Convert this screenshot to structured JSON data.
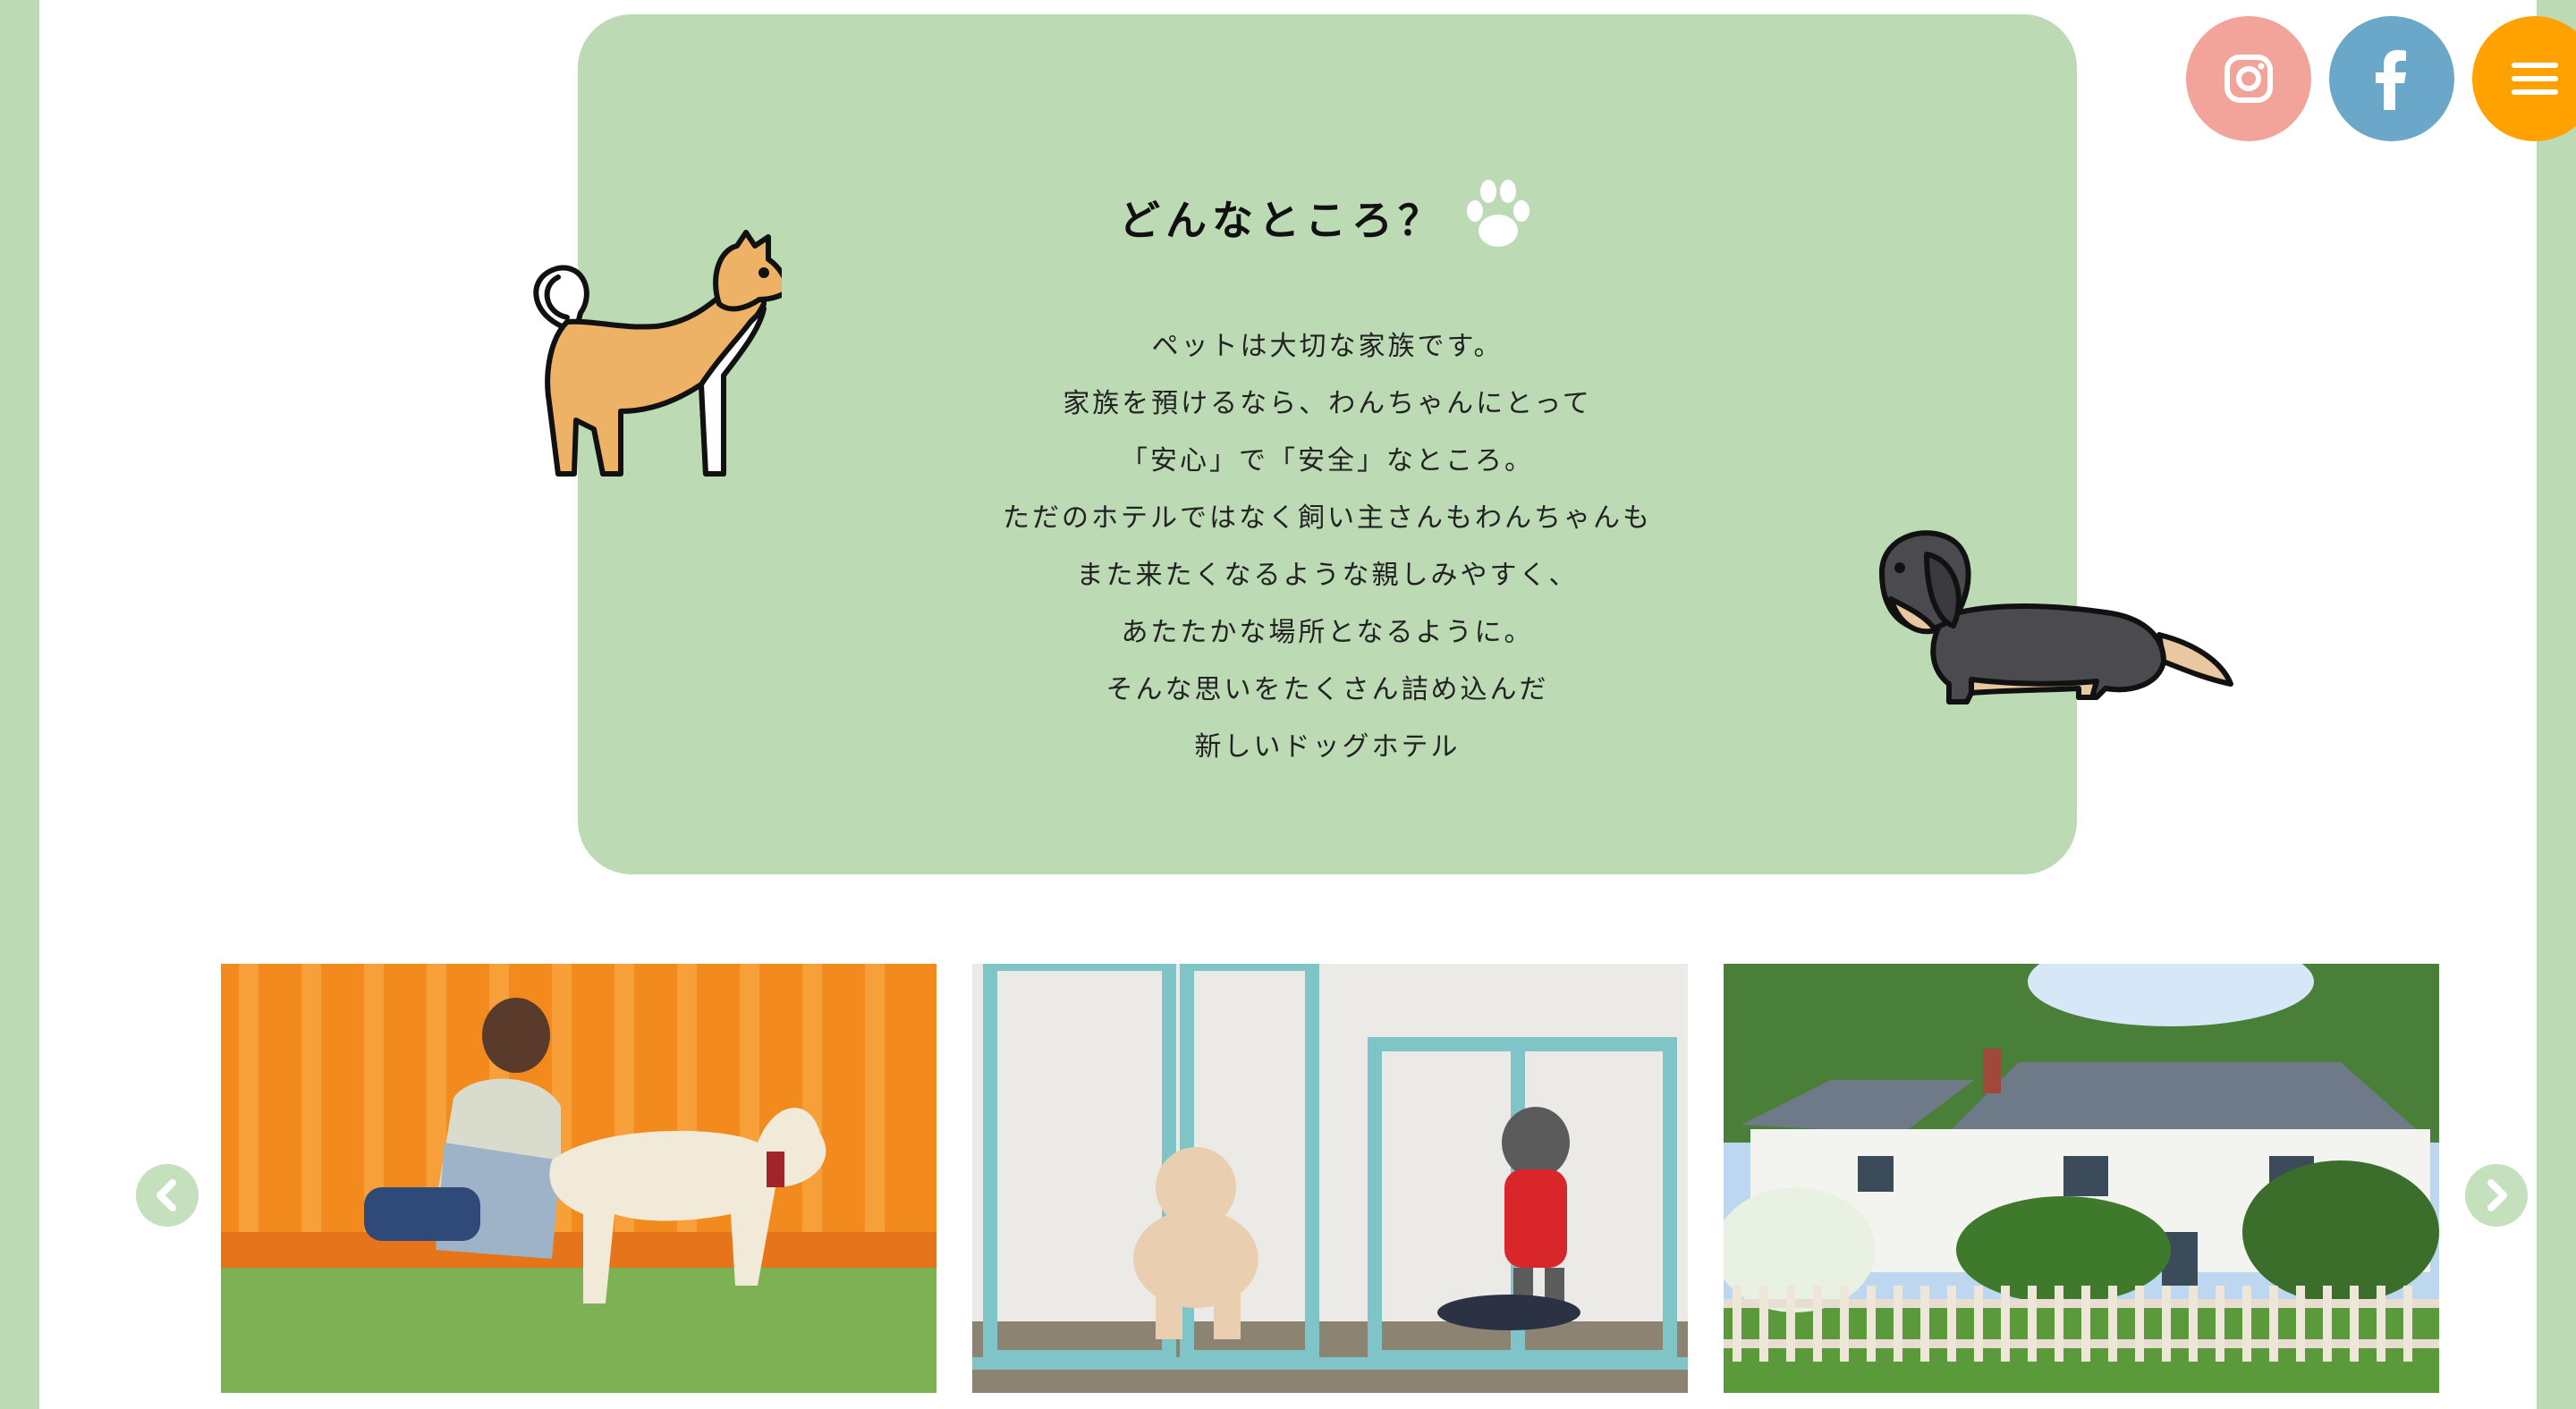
{
  "about": {
    "heading": "どんなところ？",
    "lines": [
      "ペットは大切な家族です。",
      "家族を預けるなら、わんちゃんにとって",
      "「安心」で「安全」なところ。",
      "ただのホテルではなく飼い主さんもわんちゃんも",
      "また来たくなるような親しみやすく、",
      "あたたかな場所となるように。",
      "そんな思いをたくさん詰め込んだ",
      "新しいドッグホテル"
    ]
  },
  "social": {
    "instagram_icon": "instagram-icon",
    "facebook_icon": "facebook-icon",
    "menu_icon": "hamburger-menu-icon"
  },
  "colors": {
    "background_green": "#bcdbb5",
    "instagram": "#f2a39a",
    "facebook": "#6aa7c8",
    "menu": "#ffa200"
  },
  "gallery": {
    "photos": [
      "woman-brushing-dog-photo",
      "dog-kennel-rooms-photo",
      "house-with-garden-photo"
    ],
    "prev_icon": "chevron-left-icon",
    "next_icon": "chevron-right-icon"
  }
}
